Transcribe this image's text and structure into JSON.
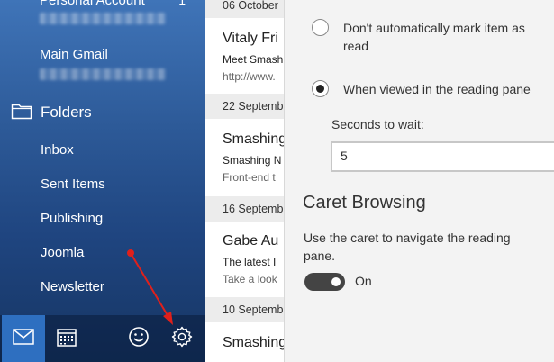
{
  "sidebar": {
    "accounts": [
      {
        "label": "Personal Account",
        "count": "1"
      },
      {
        "label": "Main Gmail"
      }
    ],
    "folders_label": "Folders",
    "folders": [
      "Inbox",
      "Sent Items",
      "Publishing",
      "Joomla",
      "Newsletter"
    ],
    "bottom_bar": [
      {
        "icon": "mail-icon",
        "active": true
      },
      {
        "icon": "calendar-icon",
        "active": false
      },
      {
        "icon": "smiley-icon",
        "active": false
      },
      {
        "icon": "gear-icon",
        "active": false
      }
    ]
  },
  "mail_list": {
    "groups": [
      {
        "date": "06 October",
        "messages": [
          {
            "from": "Vitaly Fri",
            "subject": "Meet Smash",
            "preview": "http://www."
          }
        ]
      },
      {
        "date": "22 Septemb",
        "messages": [
          {
            "from": "Smashing",
            "subject": "Smashing N",
            "preview": "Front-end t"
          }
        ]
      },
      {
        "date": "16 Septemb",
        "messages": [
          {
            "from": "Gabe Au",
            "subject": "The latest I",
            "preview": "Take a look"
          }
        ]
      },
      {
        "date": "10 Septemb",
        "messages": [
          {
            "from": "Smashing",
            "subject": "",
            "preview": ""
          }
        ]
      }
    ]
  },
  "settings": {
    "options": [
      {
        "label_lines": [
          "Don't automatically mark item as",
          "read"
        ],
        "checked": false
      },
      {
        "label_lines": [
          "When viewed in the reading pane"
        ],
        "checked": true
      }
    ],
    "seconds_label": "Seconds to wait:",
    "seconds_value": "5",
    "caret_title": "Caret Browsing",
    "caret_desc_lines": [
      "Use the caret to navigate the reading",
      "pane."
    ],
    "caret_toggle_label": "On",
    "caret_toggle_on": true
  },
  "colors": {
    "accent": "#2e6fc0",
    "annotation_arrow": "#e0201b"
  }
}
